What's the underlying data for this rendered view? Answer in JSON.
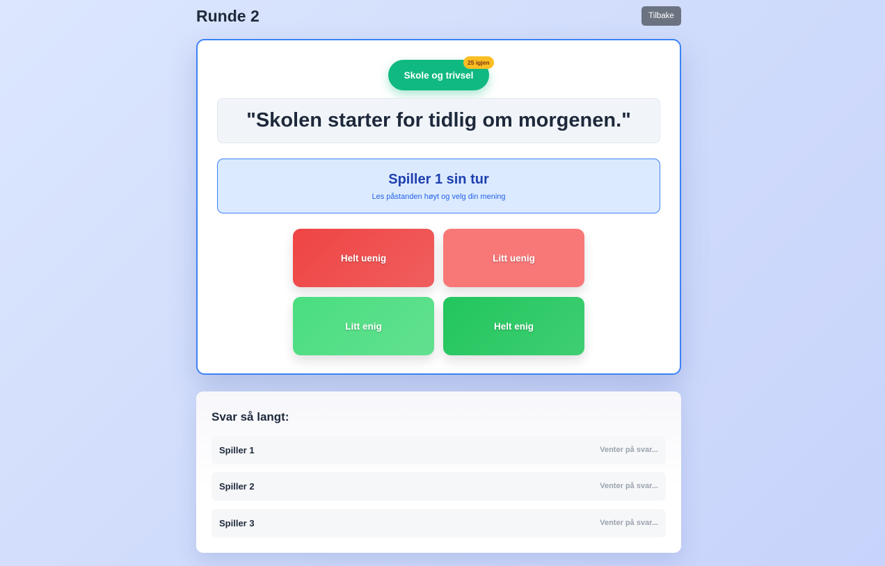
{
  "header": {
    "round_title": "Runde 2",
    "back_label": "Tilbake"
  },
  "question": {
    "category": "Skole og trivsel",
    "remaining_badge": "25 igjen",
    "statement": "\"Skolen starter for tidlig om morgenen.\"",
    "turn_title": "Spiller 1 sin tur",
    "turn_instruction": "Les påstanden høyt og velg din mening"
  },
  "answer_options": [
    {
      "label": "Helt uenig",
      "color": "#ef4444"
    },
    {
      "label": "Litt uenig",
      "color": "#f87878"
    },
    {
      "label": "Litt enig",
      "color": "#4ade80"
    },
    {
      "label": "Helt enig",
      "color": "#22c55e"
    }
  ],
  "answers_so_far": {
    "title": "Svar så langt:",
    "players": [
      {
        "name": "Spiller 1",
        "status": "Venter på svar..."
      },
      {
        "name": "Spiller 2",
        "status": "Venter på svar..."
      },
      {
        "name": "Spiller 3",
        "status": "Venter på svar..."
      }
    ]
  },
  "colors": {
    "accent": "#3b82f6",
    "category_pill": "#10b981",
    "badge": "#fbbf24",
    "back_button": "#6b7280"
  }
}
